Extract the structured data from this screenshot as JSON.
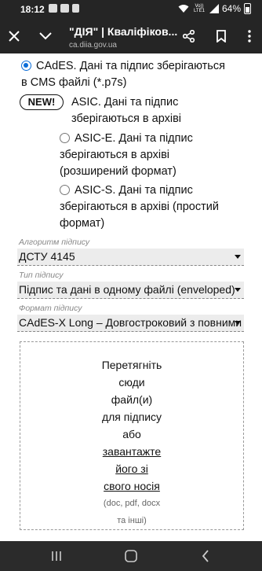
{
  "status_bar": {
    "time": "18:12",
    "network": "Vo)) LTE1",
    "battery": "64%"
  },
  "browser": {
    "title": "\"ДІЯ\" | Кваліфіков...",
    "url": "ca.diia.gov.ua",
    "icons": [
      "close-icon",
      "chevron-down-icon",
      "share-icon",
      "bookmark-icon",
      "more-icon"
    ]
  },
  "format_options": [
    {
      "label_line1": "CAdES. Дані та підпис зберігаються",
      "label_line2": "в CMS файлі (*.p7s)",
      "checked": true
    },
    {
      "badge": "NEW!",
      "label_line1": "ASIC. Дані та підпис",
      "label_line2": "зберігаються в архіві"
    },
    {
      "label_line1": "ASIC-E. Дані та підпис",
      "label_line2": "зберігаються в архіві",
      "label_line3": "(розширений формат)",
      "checked": false
    },
    {
      "label_line1": "ASIC-S. Дані та підпис",
      "label_line2": "зберігаються в архіві (простий",
      "label_line3": "формат)",
      "checked": false
    }
  ],
  "fields": {
    "algorithm": {
      "label": "Алгоритм підпису",
      "value": "ДСТУ 4145"
    },
    "sign_type": {
      "label": "Тип підпису",
      "value": "Підпис та дані в одному файлі (enveloped)"
    },
    "sign_format": {
      "label": "Формат підпису",
      "value": "CAdES-X Long – Довгостроковий з повними даними"
    }
  },
  "dropzone": {
    "line1": "Перетягніть",
    "line2": "сюди",
    "line3": "файл(и)",
    "line4": "для підпису",
    "line5": "або",
    "link1": "завантажте",
    "link2": "його зі",
    "link3": "свого носія",
    "hint1": "(doc, pdf, docx",
    "hint2": "та інші)"
  },
  "colors": {
    "radio_checked": "#0b6dd8",
    "toolbar_bg": "#252525"
  }
}
